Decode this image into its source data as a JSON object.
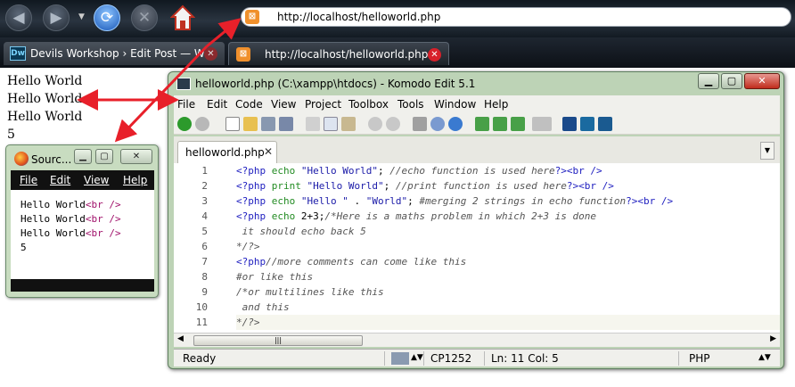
{
  "browser": {
    "url": "http://localhost/helloworld.php",
    "tabs": [
      {
        "label": "Devils Workshop › Edit Post — Wor...",
        "icon": "dreamweaver-icon"
      },
      {
        "label": "http://localhost/helloworld.php",
        "icon": "xampp-icon"
      }
    ]
  },
  "page": {
    "lines": [
      "Hello World",
      "Hello World",
      "Hello World",
      "5"
    ]
  },
  "source_window": {
    "title": "Sourc...",
    "menu": [
      "File",
      "Edit",
      "View",
      "Help"
    ],
    "lines": [
      {
        "text": "Hello World",
        "tag": "<br />"
      },
      {
        "text": "Hello World",
        "tag": "<br />"
      },
      {
        "text": "Hello World",
        "tag": "<br />"
      },
      {
        "text": "5",
        "tag": ""
      }
    ]
  },
  "komodo": {
    "title": "helloworld.php (C:\\xampp\\htdocs) - Komodo Edit 5.1",
    "menu": [
      "File",
      "Edit",
      "Code",
      "View",
      "Project",
      "Toolbox",
      "Tools",
      "Window",
      "Help"
    ],
    "tab": "helloworld.php",
    "line_numbers": [
      "1",
      "2",
      "3",
      "4",
      "5",
      "6",
      "7",
      "8",
      "9",
      "10",
      "11"
    ],
    "code": {
      "l1": [
        "<?php",
        " echo ",
        "\"Hello World\"",
        "; ",
        "//echo function is used here",
        "?>",
        "<br />"
      ],
      "l2": [
        "<?php",
        " print ",
        "\"Hello World\"",
        "; ",
        "//print function is used here",
        "?>",
        "<br />"
      ],
      "l3": [
        "<?php",
        " echo ",
        "\"Hello \"",
        " . ",
        "\"World\"",
        "; ",
        "#merging 2 strings in echo function",
        "?>",
        "<br />"
      ],
      "l4": [
        "<?php",
        " echo ",
        "2+3",
        ";",
        "/*Here is a maths problem in which 2+3 is done"
      ],
      "l5": " it should echo back 5",
      "l6": "*/?>",
      "l7": [
        "<?php",
        "//more comments can come like this"
      ],
      "l8": "#or like this",
      "l9": "/*or multilines like this",
      "l10": " and this",
      "l11": "*/?>"
    },
    "status": {
      "ready": "Ready",
      "encoding": "CP1252",
      "position": "Ln: 11 Col: 5",
      "language": "PHP"
    }
  },
  "colors": {
    "annotation_arrow": "#e8202a",
    "keyword": "#228b22",
    "string": "#1a1aa8",
    "comment": "#555555",
    "html_tag": "#2020c0"
  }
}
